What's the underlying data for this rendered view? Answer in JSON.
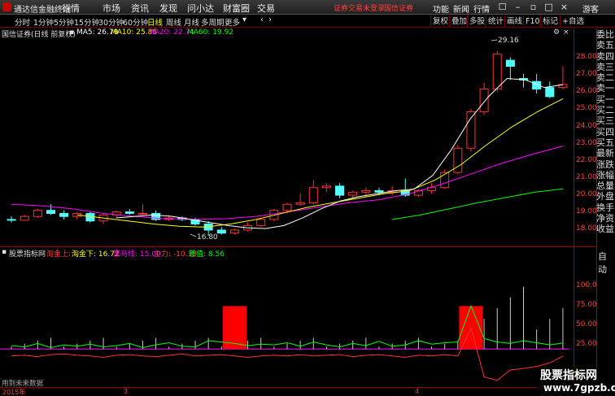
{
  "app": {
    "title": "通达信金融终端",
    "menus": [
      "行情",
      "市场",
      "资讯",
      "发现",
      "问小达",
      "财富圈",
      "交易"
    ],
    "notice_1": "证券交易未登录",
    "notice_2": "国信证券",
    "right_menus": [
      "功能",
      "新闻",
      "行情",
      "游客"
    ]
  },
  "toolbar": {
    "periods": [
      "分时",
      "1分钟",
      "5分钟",
      "15分钟",
      "30分钟",
      "60分钟",
      "日线",
      "周线",
      "月线",
      "多周期",
      "更多"
    ],
    "active_period": "日线",
    "buttons": [
      "复权",
      "叠加",
      "多股",
      "统计",
      "画线",
      "F10",
      "标记",
      "+自选"
    ]
  },
  "main_chart": {
    "stock_title": "国信证券(日线 前复权)",
    "ma5": "MA5: 26.79",
    "ma10": "MA10: 25.86",
    "ma20": "MA20: 22.74",
    "ma60": "MA60: 19.92",
    "high_marker": "29.16",
    "low_marker": "16.80",
    "price_labels": [
      "28.00",
      "27.00",
      "26.00",
      "25.00",
      "24.00",
      "23.00",
      "22.00",
      "21.00",
      "20.00",
      "19.00",
      "18.00"
    ],
    "colors": {
      "ma5": "#ffffff",
      "ma10": "#ffff00",
      "ma20": "#ff00ff",
      "ma60": "#00ff00",
      "up": "#ff3232",
      "down": "#54ffff"
    }
  },
  "indicator": {
    "name": "股票指标网",
    "line1": "淘金上:",
    "line2": "淘金下: 16.72",
    "line3": "黑马线: 15.00",
    "line4": "主力: -10.18",
    "line5": "差值: 8.56",
    "labels": [
      "100.0",
      "75.00",
      "50.00",
      "25.00"
    ]
  },
  "side_panel": {
    "items": [
      "委比",
      "卖五",
      "卖四",
      "卖三",
      "卖二",
      "卖一",
      "买一",
      "买二",
      "买三",
      "买四",
      "买五",
      "最新",
      "涨跌",
      "涨幅",
      "总量",
      "外盘",
      "换手",
      "净资",
      "收益"
    ],
    "auto_label": "自动"
  },
  "bottom_axis": {
    "year": "2015年",
    "m3": "3",
    "m4": "4"
  },
  "future_note": "用到未来数据",
  "watermark": {
    "line1": "股票指标网",
    "line2": "www.7gpzb.com"
  },
  "chart_data": {
    "type": "candlestick",
    "ylim": [
      16.5,
      29.8
    ],
    "candles": [
      [
        17.9,
        18.1,
        17.7,
        17.85
      ],
      [
        17.85,
        18.2,
        17.8,
        18.1
      ],
      [
        18.1,
        18.6,
        18.0,
        18.5
      ],
      [
        18.5,
        18.9,
        18.2,
        18.3
      ],
      [
        18.3,
        18.5,
        17.9,
        18.1
      ],
      [
        18.1,
        18.4,
        17.9,
        18.3
      ],
      [
        18.3,
        18.4,
        17.7,
        17.8
      ],
      [
        17.8,
        18.3,
        17.6,
        18.2
      ],
      [
        18.2,
        18.5,
        18.0,
        18.4
      ],
      [
        18.4,
        18.6,
        18.2,
        18.3
      ],
      [
        18.3,
        18.9,
        18.2,
        18.3
      ],
      [
        18.3,
        18.5,
        17.8,
        17.9
      ],
      [
        17.9,
        18.2,
        17.8,
        18.0
      ],
      [
        18.0,
        18.1,
        17.8,
        17.9
      ],
      [
        17.9,
        18.0,
        17.5,
        17.6
      ],
      [
        17.6,
        17.8,
        16.8,
        17.2
      ],
      [
        17.2,
        17.4,
        16.9,
        17.0
      ],
      [
        17.0,
        17.3,
        16.9,
        17.2
      ],
      [
        17.2,
        17.7,
        17.1,
        17.5
      ],
      [
        17.5,
        18.0,
        17.4,
        17.9
      ],
      [
        17.9,
        18.6,
        17.8,
        18.5
      ],
      [
        18.5,
        19.0,
        18.3,
        18.9
      ],
      [
        18.9,
        19.6,
        18.8,
        19.0
      ],
      [
        19.0,
        20.5,
        18.9,
        20.0
      ],
      [
        20.0,
        20.3,
        19.7,
        20.1
      ],
      [
        20.1,
        20.3,
        19.3,
        19.5
      ],
      [
        19.5,
        19.8,
        19.3,
        19.7
      ],
      [
        19.7,
        20.0,
        19.4,
        19.8
      ],
      [
        19.8,
        20.0,
        19.5,
        19.7
      ],
      [
        19.7,
        20.1,
        19.5,
        19.8
      ],
      [
        19.8,
        20.6,
        19.4,
        19.5
      ],
      [
        19.5,
        19.9,
        19.4,
        19.8
      ],
      [
        19.8,
        20.3,
        19.6,
        20.0
      ],
      [
        20.0,
        21.2,
        19.9,
        21.0
      ],
      [
        21.0,
        22.8,
        20.9,
        22.6
      ],
      [
        22.6,
        25.2,
        22.4,
        25.0
      ],
      [
        25.0,
        26.9,
        24.8,
        26.5
      ],
      [
        26.5,
        29.0,
        26.3,
        28.8
      ],
      [
        28.4,
        28.6,
        27.1,
        28.0
      ],
      [
        27.2,
        27.5,
        26.6,
        27.1
      ],
      [
        27.0,
        27.5,
        26.2,
        26.5
      ],
      [
        26.6,
        27.0,
        25.9,
        26.0
      ],
      [
        26.6,
        28.0,
        26.5,
        26.8
      ]
    ],
    "ma5": [
      18.0,
      18.1,
      18.2,
      18.1,
      17.9,
      17.7,
      17.5,
      17.35,
      17.3,
      17.5,
      18.0,
      18.6,
      19.1,
      19.4,
      19.6,
      19.8,
      19.9,
      20.8,
      22.5,
      24.5,
      26.0,
      27.2,
      27.1,
      26.6,
      26.79
    ],
    "ma10": [
      18.2,
      18.0,
      17.8,
      17.6,
      17.45,
      17.4,
      17.6,
      17.9,
      18.3,
      18.7,
      19.0,
      19.3,
      19.6,
      19.8,
      20.5,
      21.5,
      22.8,
      24.0,
      25.0,
      25.86
    ],
    "ma20": [
      18.9,
      18.8,
      18.6,
      18.3,
      18.1,
      17.95,
      17.9,
      17.95,
      18.1,
      18.4,
      18.7,
      19.0,
      19.2,
      19.6,
      20.2,
      20.9,
      21.6,
      22.2,
      22.74
    ],
    "ma60": [
      17.9,
      18.2,
      18.6,
      19.0,
      19.35,
      19.7,
      19.92
    ],
    "indicator_bars": [
      {
        "index": 17,
        "value": 28
      },
      {
        "index": 35,
        "value": 28
      }
    ],
    "indicator_lines": {
      "zhuli": [
        -10,
        -9,
        -11,
        -8,
        -7,
        -9,
        -10,
        -12,
        -9,
        -8,
        -10,
        -11,
        -9,
        -7,
        -10,
        -9,
        -8,
        -10,
        -12,
        -10,
        -9,
        -10,
        -8,
        -10,
        -9,
        -8,
        -11,
        -9,
        -8,
        -10,
        -12,
        -9,
        -10,
        -8,
        -10,
        30,
        -40,
        -45,
        -30,
        -28,
        -25,
        -20,
        -10.18
      ],
      "chazhi": [
        5,
        3,
        8,
        2,
        6,
        4,
        7,
        3,
        5,
        8,
        2,
        6,
        9,
        4,
        3,
        12,
        10,
        8,
        5,
        7,
        6,
        9,
        4,
        10,
        6,
        3,
        8,
        5,
        11,
        4,
        6,
        12,
        7,
        9,
        10,
        62,
        15,
        10,
        8,
        12,
        9,
        6,
        8.56
      ]
    }
  }
}
